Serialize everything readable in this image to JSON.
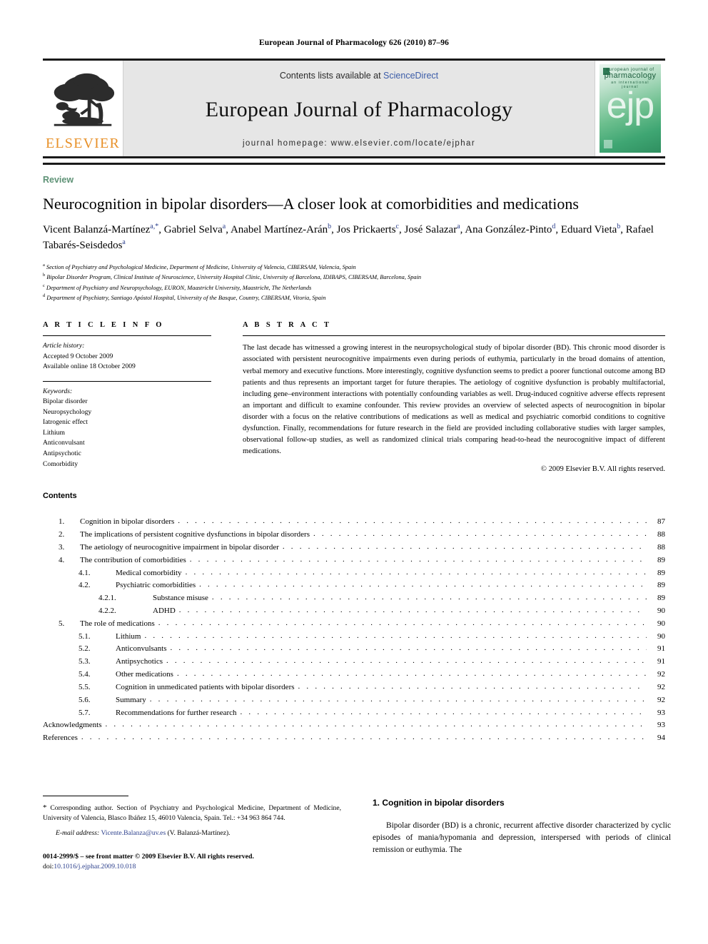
{
  "running_head": "European Journal of Pharmacology 626 (2010) 87–96",
  "masthead": {
    "elsevier_wordmark": "ELSEVIER",
    "elsevier_color": "#E8912A",
    "contents_prefix": "Contents lists available at ",
    "sciencedirect": "ScienceDirect",
    "sciencedirect_color": "#3b5ca8",
    "journal_title": "European Journal of Pharmacology",
    "homepage": "journal homepage: www.elsevier.com/locate/ejphar",
    "cover": {
      "line1": "european journal of",
      "line2": "pharmacology",
      "line3": "an international journal",
      "logo_text": "ejp",
      "bg_color": "#3fa673"
    }
  },
  "article": {
    "type_label": "Review",
    "type_label_color": "#5e9276",
    "title": "Neurocognition in bipolar disorders—A closer look at comorbidities and medications",
    "authors_line1": "Vicent Balanzá-Martínez",
    "authors": [
      {
        "name": "Vicent Balanzá-Martínez",
        "marks": "a,*"
      },
      {
        "name": "Gabriel Selva",
        "marks": "a"
      },
      {
        "name": "Anabel Martínez-Arán",
        "marks": "b"
      },
      {
        "name": "Jos Prickaerts",
        "marks": "c"
      },
      {
        "name": "José Salazar",
        "marks": "a"
      },
      {
        "name": "Ana González-Pinto",
        "marks": "d"
      },
      {
        "name": "Eduard Vieta",
        "marks": "b"
      },
      {
        "name": "Rafael Tabarés-Seisdedos",
        "marks": "a"
      }
    ],
    "affiliations": [
      {
        "mark": "a",
        "text": "Section of Psychiatry and Psychological Medicine, Department of Medicine, University of Valencia, CIBERSAM, Valencia, Spain"
      },
      {
        "mark": "b",
        "text": "Bipolar Disorder Program, Clinical Institute of Neuroscience, University Hospital Clinic, University of Barcelona, IDIBAPS, CIBERSAM, Barcelona, Spain"
      },
      {
        "mark": "c",
        "text": "Department of Psychiatry and Neuropsychology, EURON, Maastricht University, Maastricht, The Netherlands"
      },
      {
        "mark": "d",
        "text": "Department of Psychiatry, Santiago Apóstol Hospital, University of the Basque, Country, CIBERSAM, Vitoria, Spain"
      }
    ]
  },
  "article_info": {
    "heading": "A R T I C L E    I N F O",
    "history_label": "Article history:",
    "history": [
      "Accepted 9 October 2009",
      "Available online 18 October 2009"
    ],
    "keywords_label": "Keywords:",
    "keywords": [
      "Bipolar disorder",
      "Neuropsychology",
      "Iatrogenic effect",
      "Lithium",
      "Anticonvulsant",
      "Antipsychotic",
      "Comorbidity"
    ]
  },
  "abstract": {
    "heading": "A B S T R A C T",
    "body": "The last decade has witnessed a growing interest in the neuropsychological study of bipolar disorder (BD). This chronic mood disorder is associated with persistent neurocognitive impairments even during periods of euthymia, particularly in the broad domains of attention, verbal memory and executive functions. More interestingly, cognitive dysfunction seems to predict a poorer functional outcome among BD patients and thus represents an important target for future therapies. The aetiology of cognitive dysfunction is probably multifactorial, including gene–environment interactions with potentially confounding variables as well. Drug-induced cognitive adverse effects represent an important and difficult to examine confounder. This review provides an overview of selected aspects of neurocognition in bipolar disorder with a focus on the relative contributions of medications as well as medical and psychiatric comorbid conditions to cognitive dysfunction. Finally, recommendations for future research in the field are provided including collaborative studies with larger samples, observational follow-up studies, as well as randomized clinical trials comparing head-to-head the neurocognitive impact of different medications.",
    "copyright": "© 2009 Elsevier B.V. All rights reserved."
  },
  "contents": {
    "heading": "Contents",
    "entries": [
      {
        "level": 1,
        "num": "1.",
        "label": "Cognition in bipolar disorders",
        "page": "87"
      },
      {
        "level": 1,
        "num": "2.",
        "label": "The implications of persistent cognitive dysfunctions in bipolar disorders",
        "page": "88"
      },
      {
        "level": 1,
        "num": "3.",
        "label": "The aetiology of neurocognitive impairment in bipolar disorder",
        "page": "88"
      },
      {
        "level": 1,
        "num": "4.",
        "label": "The contribution of comorbidities",
        "page": "89"
      },
      {
        "level": 2,
        "num": "4.1.",
        "label": "Medical comorbidity",
        "page": "89"
      },
      {
        "level": 2,
        "num": "4.2.",
        "label": "Psychiatric comorbidities",
        "page": "89"
      },
      {
        "level": 3,
        "num": "4.2.1.",
        "label": "Substance misuse",
        "page": "89"
      },
      {
        "level": 3,
        "num": "4.2.2.",
        "label": "ADHD",
        "page": "90"
      },
      {
        "level": 1,
        "num": "5.",
        "label": "The role of medications",
        "page": "90"
      },
      {
        "level": 2,
        "num": "5.1.",
        "label": "Lithium",
        "page": "90"
      },
      {
        "level": 2,
        "num": "5.2.",
        "label": "Anticonvulsants",
        "page": "91"
      },
      {
        "level": 2,
        "num": "5.3.",
        "label": "Antipsychotics",
        "page": "91"
      },
      {
        "level": 2,
        "num": "5.4.",
        "label": "Other medications",
        "page": "92"
      },
      {
        "level": 2,
        "num": "5.5.",
        "label": "Cognition in unmedicated patients with bipolar disorders",
        "page": "92"
      },
      {
        "level": 2,
        "num": "5.6.",
        "label": "Summary",
        "page": "92"
      },
      {
        "level": 2,
        "num": "5.7.",
        "label": "Recommendations for further research",
        "page": "93"
      },
      {
        "level": 0,
        "num": "",
        "label": "Acknowledgments",
        "page": "93"
      },
      {
        "level": 0,
        "num": "",
        "label": "References",
        "page": "94"
      }
    ]
  },
  "footer": {
    "corresponding_star": "*",
    "corresponding_note": "Corresponding author. Section of Psychiatry and Psychological Medicine, Department of Medicine, University of Valencia, Blasco Ibáñez 15, 46010 Valencia, Spain. Tel.: +34 963 864 744.",
    "email_label": "E-mail address:",
    "email": "Vicente.Balanza@uv.es",
    "email_attrib": "(V. Balanzá-Martínez).",
    "imprint": "0014-2999/$ – see front matter © 2009 Elsevier B.V. All rights reserved.",
    "doi_label": "doi:",
    "doi": "10.1016/j.ejphar.2009.10.018",
    "link_color": "#2b3f8c"
  },
  "section1": {
    "heading": "1. Cognition in bipolar disorders",
    "paragraph": "Bipolar disorder (BD) is a chronic, recurrent affective disorder characterized by cyclic episodes of mania/hypomania and depression, interspersed with periods of clinical remission or euthymia. The"
  }
}
